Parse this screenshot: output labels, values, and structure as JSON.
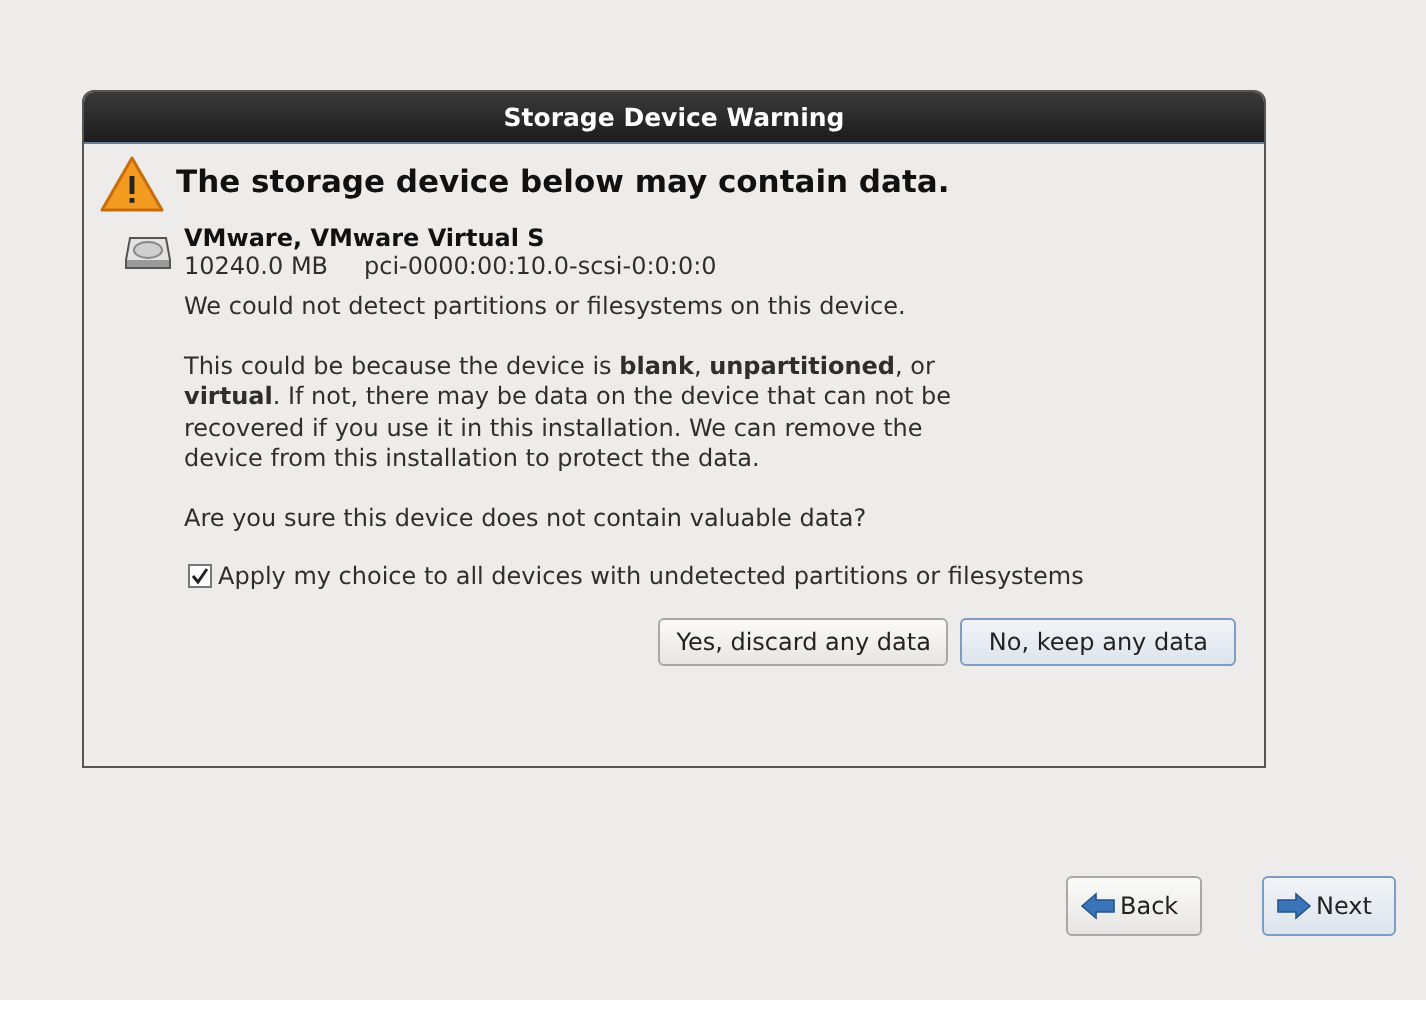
{
  "dialog": {
    "title": "Storage Device Warning",
    "heading": "The storage device below may contain data.",
    "device": {
      "name": "VMware, VMware Virtual S",
      "size": "10240.0 MB",
      "path": "pci-0000:00:10.0-scsi-0:0:0:0"
    },
    "paragraphs": [
      "We could not detect partitions or filesystems on this device.",
      "This could be because the device is **blank**, **unpartitioned**, or **virtual**. If not, there may be data on the device that can not be recovered if you use it in this installation. We can remove the device from this installation to protect the data.",
      "Are you sure this device does not contain valuable data?"
    ],
    "apply_all": {
      "label": "Apply my choice to all devices with undetected partitions or filesystems",
      "checked": true
    },
    "buttons": [
      {
        "label": "Yes, discard any data",
        "selected": false
      },
      {
        "label": "No, keep any data",
        "selected": true
      }
    ]
  },
  "nav_buttons": [
    {
      "label": "Back",
      "kind": "back",
      "selected": false
    },
    {
      "label": "Next",
      "kind": "next",
      "selected": true
    }
  ]
}
